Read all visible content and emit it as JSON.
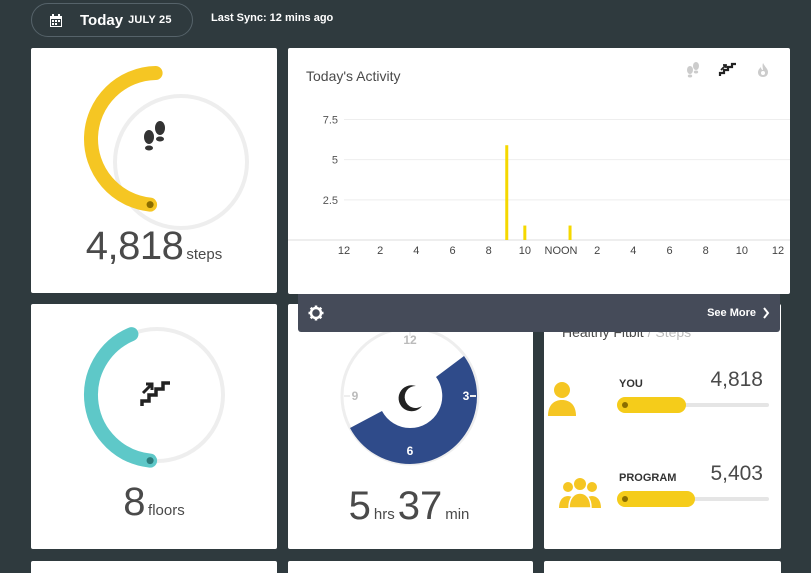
{
  "header": {
    "today_label": "Today",
    "date": "JULY 25",
    "sync": "Last Sync: 12 mins ago"
  },
  "steps": {
    "value": "4,818",
    "unit": "steps",
    "progress": 0.48,
    "color": "#f5c623"
  },
  "floors": {
    "value": "8",
    "unit": "floors",
    "progress": 0.42,
    "color": "#5ec8c8"
  },
  "activity": {
    "title": "Today's Activity",
    "icons": [
      "footsteps-icon",
      "stairs-icon",
      "flame-icon"
    ],
    "see_more": "See More"
  },
  "sleep": {
    "hours": "5",
    "hours_unit": "hrs",
    "minutes": "37",
    "minutes_unit": "min",
    "clock_labels": {
      "top": "12",
      "left": "9",
      "right": "3",
      "bottom": "6"
    }
  },
  "leaderboard": {
    "title": "Healthy Fitbit",
    "subtitle": "/ Steps",
    "rows": [
      {
        "name": "YOU",
        "value": "4,818",
        "progress": 0.48
      },
      {
        "name": "PROGRAM",
        "value": "5,403",
        "progress": 0.54
      }
    ]
  },
  "chart_data": {
    "type": "bar",
    "x_tick_labels": [
      "12",
      "2",
      "4",
      "6",
      "8",
      "10",
      "NOON",
      "2",
      "4",
      "6",
      "8",
      "10",
      "12"
    ],
    "y_tick_labels": [
      "2.5",
      "5",
      "7.5"
    ],
    "ylim": [
      0,
      8
    ],
    "hours": [
      9,
      10,
      12.5
    ],
    "values": [
      5.9,
      0.9,
      0.9
    ],
    "color": "#f5d800",
    "grid": true
  }
}
